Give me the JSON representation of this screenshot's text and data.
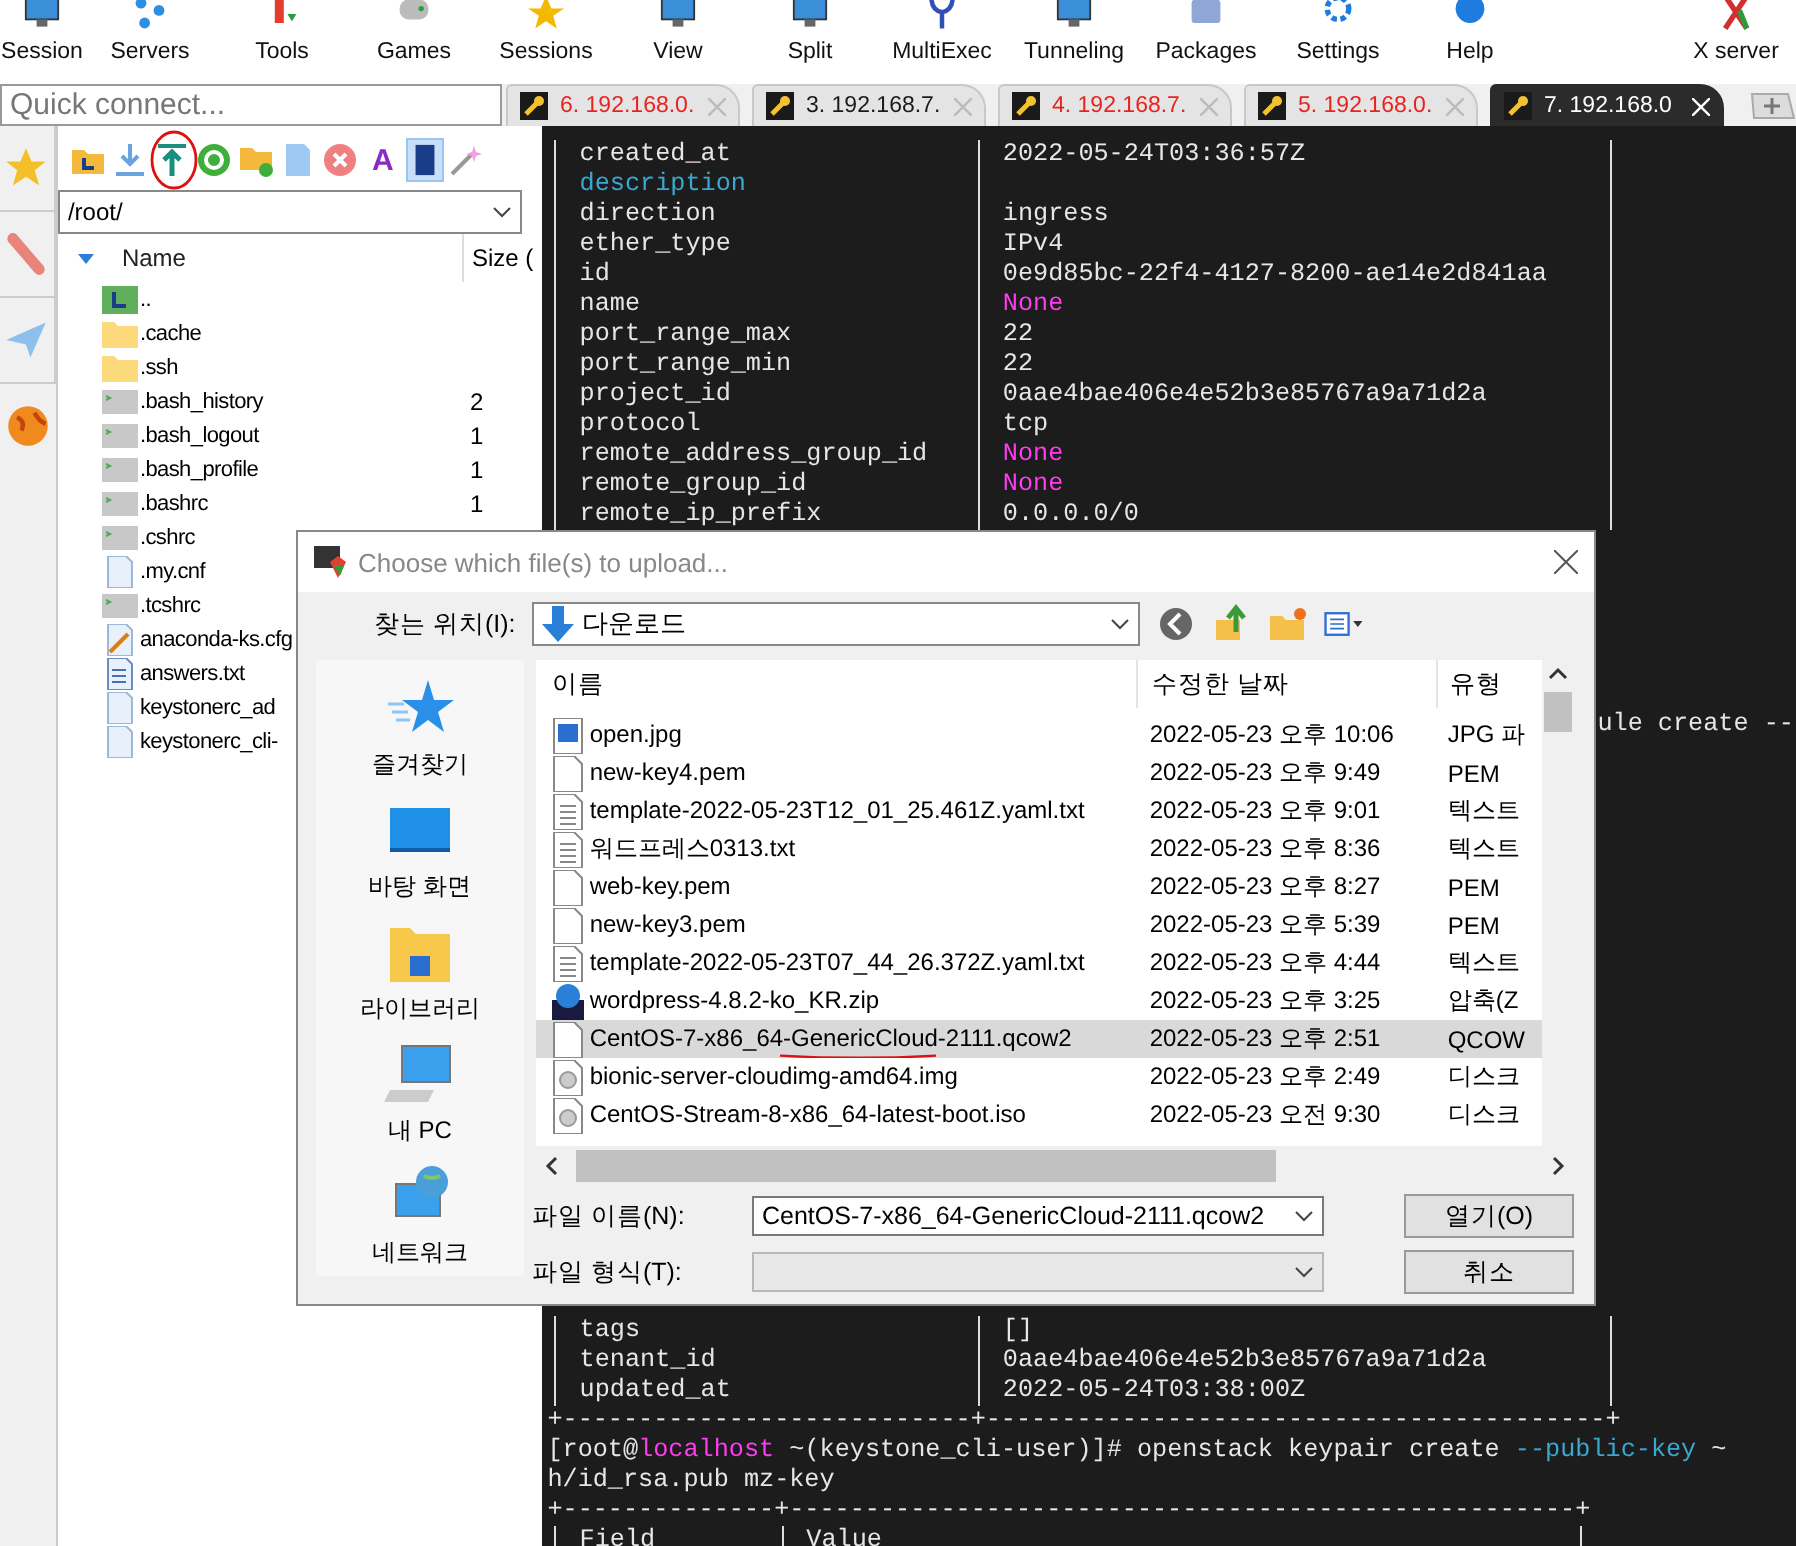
{
  "toolbar": [
    {
      "label": "Session",
      "kind": "monitor"
    },
    {
      "label": "Servers",
      "kind": "nodes"
    },
    {
      "label": "Tools",
      "kind": "tools"
    },
    {
      "label": "Games",
      "kind": "gamepad"
    },
    {
      "label": "Sessions",
      "kind": "star"
    },
    {
      "label": "View",
      "kind": "monitor"
    },
    {
      "label": "Split",
      "kind": "monitor"
    },
    {
      "label": "MultiExec",
      "kind": "fork"
    },
    {
      "label": "Tunneling",
      "kind": "monitor"
    },
    {
      "label": "Packages",
      "kind": "box"
    },
    {
      "label": "Settings",
      "kind": "gear"
    },
    {
      "label": "Help",
      "kind": "help"
    },
    {
      "label": "X server",
      "kind": "x"
    }
  ],
  "quick_connect": {
    "placeholder": "Quick connect..."
  },
  "tabs": [
    {
      "label": "6. 192.168.0.",
      "color": "#e8231f",
      "selected": false
    },
    {
      "label": "3. 192.168.7.",
      "color": "#1a1a1a",
      "selected": false
    },
    {
      "label": "4. 192.168.7.",
      "color": "#e8231f",
      "selected": false
    },
    {
      "label": "5. 192.168.0.",
      "color": "#e8231f",
      "selected": false
    },
    {
      "label": "7. 192.168.0",
      "color": "#ffffff",
      "selected": true
    }
  ],
  "side_strip": [
    {
      "kind": "star"
    },
    {
      "kind": "tools"
    },
    {
      "kind": "plane"
    },
    {
      "kind": "globe"
    }
  ],
  "sftp": {
    "tools": [
      {
        "kind": "folder-up",
        "selected": false
      },
      {
        "kind": "download",
        "selected": false
      },
      {
        "kind": "upload",
        "selected": false
      },
      {
        "kind": "refresh",
        "selected": false
      },
      {
        "kind": "new-folder",
        "selected": false
      },
      {
        "kind": "new-file",
        "selected": false
      },
      {
        "kind": "delete",
        "selected": false
      },
      {
        "kind": "glyph",
        "text": "A",
        "selected": false
      },
      {
        "kind": "terminal",
        "selected": true
      },
      {
        "kind": "wand",
        "selected": false
      }
    ],
    "path": "/root/",
    "columns": [
      "Name",
      "Size ("
    ],
    "files": [
      {
        "name": "..",
        "kind": "parent"
      },
      {
        "name": ".cache",
        "kind": "folder"
      },
      {
        "name": ".ssh",
        "kind": "folder"
      },
      {
        "name": ".bash_history",
        "size": "2",
        "kind": "script"
      },
      {
        "name": ".bash_logout",
        "size": "1",
        "kind": "script"
      },
      {
        "name": ".bash_profile",
        "size": "1",
        "kind": "script"
      },
      {
        "name": ".bashrc",
        "size": "1",
        "kind": "script"
      },
      {
        "name": ".cshrc",
        "kind": "script"
      },
      {
        "name": ".my.cnf",
        "kind": "file"
      },
      {
        "name": ".tcshrc",
        "kind": "script"
      },
      {
        "name": "anaconda-ks.cfg",
        "kind": "config"
      },
      {
        "name": "answers.txt",
        "kind": "text"
      },
      {
        "name": "keystonerc_ad",
        "kind": "file"
      },
      {
        "name": "keystonerc_cli-",
        "kind": "file"
      }
    ]
  },
  "terminal": {
    "top_rows": [
      {
        "key": "created_at",
        "value": "2022-05-24T03:36:57Z",
        "kind": "plain"
      },
      {
        "key": "description",
        "kind": "highlight"
      },
      {
        "key": "direction",
        "value": "ingress",
        "kind": "plain"
      },
      {
        "key": "ether_type",
        "value": "IPv4",
        "kind": "plain"
      },
      {
        "key": "id",
        "value": "0e9d85bc-22f4-4127-8200-ae14e2d841aa",
        "kind": "plain"
      },
      {
        "key": "name",
        "value": "None",
        "kind": "null"
      },
      {
        "key": "port_range_max",
        "value": "22",
        "kind": "plain"
      },
      {
        "key": "port_range_min",
        "value": "22",
        "kind": "plain"
      },
      {
        "key": "project_id",
        "value": "0aae4bae406e4e52b3e85767a9a71d2a",
        "kind": "plain"
      },
      {
        "key": "protocol",
        "value": "tcp",
        "kind": "plain"
      },
      {
        "key": "remote_address_group_id",
        "value": "None",
        "kind": "null"
      },
      {
        "key": "remote_group_id",
        "value": "None",
        "kind": "null"
      },
      {
        "key": "remote_ip_prefix",
        "value": "0.0.0.0/0",
        "kind": "plain"
      }
    ],
    "fragment": "ule create --",
    "bottom_lines": [
      {
        "kind": "row",
        "key": "tags",
        "value": "[]"
      },
      {
        "kind": "row",
        "key": "tenant_id",
        "value": "0aae4bae406e4e52b3e85767a9a71d2a"
      },
      {
        "kind": "row",
        "key": "updated_at",
        "value": "2022-05-24T03:38:00Z"
      },
      {
        "kind": "rule",
        "text": "+---------------------------+-----------------------------------------+"
      },
      {
        "kind": "text",
        "segments": [
          {
            "text": "[root@",
            "kind": "plain"
          },
          {
            "text": "localhost",
            "kind": "host"
          },
          {
            "text": " ~(keystone_cli-user)]# openstack keypair create ",
            "kind": "plain"
          },
          {
            "text": "--public-key",
            "kind": "option"
          },
          {
            "text": " ~",
            "kind": "plain"
          }
        ]
      },
      {
        "kind": "text",
        "segments": [
          {
            "text": "h/id_rsa.pub mz-key",
            "kind": "plain"
          }
        ]
      },
      {
        "kind": "rule",
        "text": "+--------------+----------------------------------------------------+"
      },
      {
        "kind": "header",
        "key": "Field",
        "value": "Value"
      }
    ]
  },
  "dialog": {
    "title": "Choose which file(s) to upload...",
    "look_in_label": "찾는 위치(I):",
    "look_in": "다운로드",
    "places": [
      {
        "label": "즐겨찾기",
        "kind": "star"
      },
      {
        "label": "바탕 화면",
        "kind": "desktop"
      },
      {
        "label": "라이브러리",
        "kind": "library"
      },
      {
        "label": "내 PC",
        "kind": "pc"
      },
      {
        "label": "네트워크",
        "kind": "network"
      }
    ],
    "columns": [
      "이름",
      "수정한 날짜",
      "유형"
    ],
    "files": [
      {
        "name": "open.jpg",
        "date": "2022-05-23 오후 10:06",
        "type": "JPG 파",
        "kind": "image",
        "selected": false
      },
      {
        "name": "new-key4.pem",
        "date": "2022-05-23 오후 9:49",
        "type": "PEM",
        "kind": "blank",
        "selected": false
      },
      {
        "name": "template-2022-05-23T12_01_25.461Z.yaml.txt",
        "date": "2022-05-23 오후 9:01",
        "type": "텍스트",
        "kind": "text",
        "selected": false
      },
      {
        "name": "워드프레스0313.txt",
        "date": "2022-05-23 오후 8:36",
        "type": "텍스트",
        "kind": "text",
        "selected": false
      },
      {
        "name": "web-key.pem",
        "date": "2022-05-23 오후 8:27",
        "type": "PEM",
        "kind": "blank",
        "selected": false
      },
      {
        "name": "new-key3.pem",
        "date": "2022-05-23 오후 5:39",
        "type": "PEM",
        "kind": "blank",
        "selected": false
      },
      {
        "name": "template-2022-05-23T07_44_26.372Z.yaml.txt",
        "date": "2022-05-23 오후 4:44",
        "type": "텍스트",
        "kind": "text",
        "selected": false
      },
      {
        "name": "wordpress-4.8.2-ko_KR.zip",
        "date": "2022-05-23 오후 3:25",
        "type": "압축(Z",
        "kind": "zip",
        "selected": false
      },
      {
        "name": "CentOS-7-x86_64-GenericCloud-2111.qcow2",
        "date": "2022-05-23 오후 2:51",
        "type": "QCOW",
        "kind": "blank",
        "selected": true
      },
      {
        "name": "bionic-server-cloudimg-amd64.img",
        "date": "2022-05-23 오후 2:49",
        "type": "디스크",
        "kind": "disc",
        "selected": false
      },
      {
        "name": "CentOS-Stream-8-x86_64-latest-boot.iso",
        "date": "2022-05-23 오전 9:30",
        "type": "디스크",
        "kind": "disc",
        "selected": false
      }
    ],
    "file_name_label": "파일 이름(N):",
    "file_name": "CentOS-7-x86_64-GenericCloud-2111.qcow2",
    "file_type_label": "파일 형식(T):",
    "buttons": [
      "열기(O)",
      "취소"
    ]
  }
}
